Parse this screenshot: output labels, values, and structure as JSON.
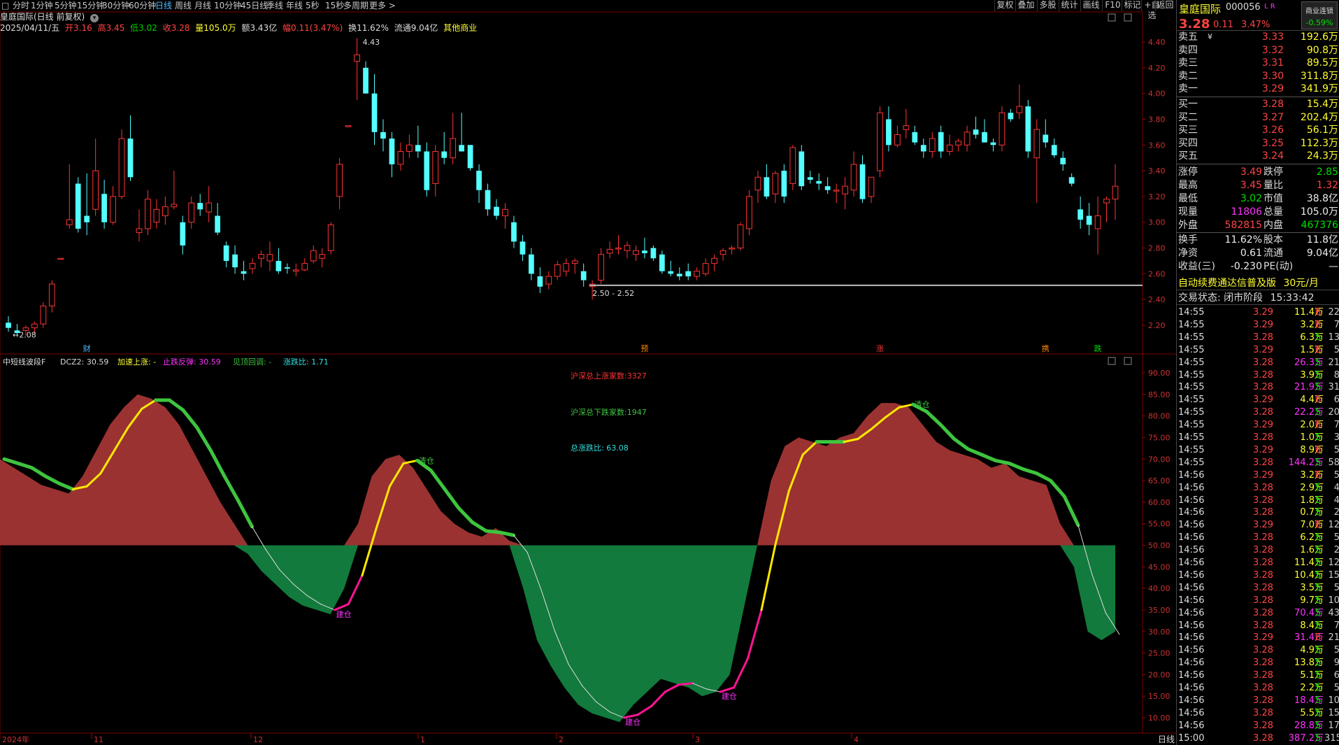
{
  "toolbar": {
    "periods": [
      "分时",
      "1分钟",
      "5分钟",
      "15分钟",
      "30分钟",
      "60分钟",
      "日线",
      "周线",
      "月线",
      "10分钟",
      "45日线",
      "季线",
      "年线",
      "5秒",
      "15秒",
      "多周期",
      "更多 >"
    ],
    "active": "日线",
    "right_buttons": [
      "复权",
      "叠加",
      "多股",
      "统计",
      "画线",
      "F10",
      "标记",
      "+自选",
      "返回"
    ]
  },
  "title": "皇庭国际(日线 前复权)",
  "infobar": {
    "date": "2025/04/11/五",
    "open": "开3.16",
    "high": "高3.45",
    "low": "低3.02",
    "close": "收3.28",
    "volume": "量105.0万",
    "amount": "额3.43亿",
    "change": "幅0.11(3.47%)",
    "turnover": "换11.62%",
    "float": "流通9.04亿",
    "other": "其他商业"
  },
  "price_axis": [
    "4.40",
    "4.20",
    "4.00",
    "3.80",
    "3.60",
    "3.40",
    "3.20",
    "3.00",
    "2.80",
    "2.60",
    "2.40",
    "2.20"
  ],
  "annotations": {
    "high_mark": "4.43",
    "low_mark": "←2.08",
    "range_label": "2.50 - 2.52",
    "events": [
      "财",
      "预",
      "涨",
      "携",
      "跌"
    ]
  },
  "indicator": {
    "name": "中短线波段F",
    "dcz2": "DCZ2: 30.59",
    "accel": "加速上涨: -",
    "stop": "止跌反弹: 30.59",
    "top": "见顶回调: -",
    "ratio": "涨跌比: 1.71",
    "up_count": "沪深总上涨家数:3327",
    "down_count": "沪深总下跌家数:1947",
    "total_ratio": "总涨跌比: 63.08",
    "axis": [
      "90.00",
      "85.00",
      "80.00",
      "75.00",
      "70.00",
      "65.00",
      "60.00",
      "55.00",
      "50.00",
      "45.00",
      "40.00",
      "35.00",
      "30.00",
      "25.00",
      "20.00",
      "15.00",
      "10.00"
    ],
    "signals": [
      "建仓",
      "清仓"
    ]
  },
  "date_axis": [
    "2024年",
    "11",
    "12",
    "1",
    "2",
    "3",
    "4"
  ],
  "period_label": "日线",
  "quote": {
    "name": "皇庭国际",
    "code": "000056",
    "flags": "L R",
    "price": "3.28",
    "change": "0.11",
    "pct": "3.47%",
    "badge_top": "商业连锁",
    "badge_pct": "-0.59%"
  },
  "sell_orders": [
    {
      "label": "卖五",
      "mark": "¥",
      "price": "3.33",
      "vol": "192.6万"
    },
    {
      "label": "卖四",
      "mark": "",
      "price": "3.32",
      "vol": "90.8万"
    },
    {
      "label": "卖三",
      "mark": "",
      "price": "3.31",
      "vol": "89.5万"
    },
    {
      "label": "卖二",
      "mark": "",
      "price": "3.30",
      "vol": "311.8万"
    },
    {
      "label": "卖一",
      "mark": "",
      "price": "3.29",
      "vol": "341.9万"
    }
  ],
  "buy_orders": [
    {
      "label": "买一",
      "price": "3.28",
      "vol": "15.4万"
    },
    {
      "label": "买二",
      "price": "3.27",
      "vol": "202.4万"
    },
    {
      "label": "买三",
      "price": "3.26",
      "vol": "56.1万"
    },
    {
      "label": "买四",
      "price": "3.25",
      "vol": "112.3万"
    },
    {
      "label": "买五",
      "price": "3.24",
      "vol": "24.3万"
    }
  ],
  "stats": [
    {
      "l1": "涨停",
      "v1": "3.49",
      "c1": "red",
      "l2": "跌停",
      "v2": "2.85",
      "c2": "green"
    },
    {
      "l1": "最高",
      "v1": "3.45",
      "c1": "red",
      "l2": "量比",
      "v2": "1.32",
      "c2": "red"
    },
    {
      "l1": "最低",
      "v1": "3.02",
      "c1": "green",
      "l2": "市值",
      "v2": "38.8亿",
      "c2": "white"
    },
    {
      "l1": "现量",
      "v1": "11806",
      "c1": "mag",
      "l2": "总量",
      "v2": "105.0万",
      "c2": "white"
    },
    {
      "l1": "外盘",
      "v1": "582815",
      "c1": "red",
      "l2": "内盘",
      "v2": "467376",
      "c2": "green"
    },
    {
      "l1": "换手",
      "v1": "11.62%",
      "c1": "white",
      "l2": "股本",
      "v2": "11.8亿",
      "c2": "white"
    },
    {
      "l1": "净资",
      "v1": "0.61",
      "c1": "white",
      "l2": "流通",
      "v2": "9.04亿",
      "c2": "white"
    },
    {
      "l1": "收益(三)",
      "v1": "-0.230",
      "c1": "white",
      "l2": "PE(动)",
      "v2": "—",
      "c2": "white"
    }
  ],
  "promo": "自动续费通达信普及版",
  "promo_price": "30元/月",
  "trade_status": "交易状态: 闭市阶段",
  "trade_time": "15:33:42",
  "ticks": [
    {
      "t": "14:55",
      "p": "3.29",
      "v": "11.4万",
      "bs": "B",
      "n": "22"
    },
    {
      "t": "14:55",
      "p": "3.29",
      "v": "3.2万",
      "bs": "B",
      "n": "7"
    },
    {
      "t": "14:55",
      "p": "3.28",
      "v": "6.3万",
      "bs": "S",
      "n": "13"
    },
    {
      "t": "14:55",
      "p": "3.29",
      "v": "1.5万",
      "bs": "B",
      "n": "5"
    },
    {
      "t": "14:55",
      "p": "3.28",
      "v": "26.3万",
      "bs": "S",
      "n": "21"
    },
    {
      "t": "14:55",
      "p": "3.28",
      "v": "3.9万",
      "bs": "S",
      "n": "8"
    },
    {
      "t": "14:55",
      "p": "3.28",
      "v": "21.9万",
      "bs": "S",
      "n": "31"
    },
    {
      "t": "14:55",
      "p": "3.29",
      "v": "4.4万",
      "bs": "B",
      "n": "6"
    },
    {
      "t": "14:55",
      "p": "3.28",
      "v": "22.2万",
      "bs": "S",
      "n": "20"
    },
    {
      "t": "14:55",
      "p": "3.29",
      "v": "2.0万",
      "bs": "B",
      "n": "7"
    },
    {
      "t": "14:55",
      "p": "3.28",
      "v": "1.0万",
      "bs": "S",
      "n": "3"
    },
    {
      "t": "14:55",
      "p": "3.29",
      "v": "8.9万",
      "bs": "B",
      "n": "5"
    },
    {
      "t": "14:55",
      "p": "3.28",
      "v": "144.2万",
      "bs": "S",
      "n": "58"
    },
    {
      "t": "14:56",
      "p": "3.29",
      "v": "3.2万",
      "bs": "B",
      "n": "5"
    },
    {
      "t": "14:56",
      "p": "3.28",
      "v": "2.9万",
      "bs": "S",
      "n": "4"
    },
    {
      "t": "14:56",
      "p": "3.28",
      "v": "1.8万",
      "bs": "S",
      "n": "4"
    },
    {
      "t": "14:56",
      "p": "3.28",
      "v": "0.7万",
      "bs": "S",
      "n": "2"
    },
    {
      "t": "14:56",
      "p": "3.29",
      "v": "7.0万",
      "bs": "B",
      "n": "12"
    },
    {
      "t": "14:56",
      "p": "3.28",
      "v": "6.2万",
      "bs": "S",
      "n": "5"
    },
    {
      "t": "14:56",
      "p": "3.28",
      "v": "1.6万",
      "bs": "S",
      "n": "2"
    },
    {
      "t": "14:56",
      "p": "3.28",
      "v": "11.4万",
      "bs": "S",
      "n": "12"
    },
    {
      "t": "14:56",
      "p": "3.28",
      "v": "10.4万",
      "bs": "S",
      "n": "15"
    },
    {
      "t": "14:56",
      "p": "3.28",
      "v": "3.5万",
      "bs": "S",
      "n": "5"
    },
    {
      "t": "14:56",
      "p": "3.28",
      "v": "9.7万",
      "bs": "S",
      "n": "10"
    },
    {
      "t": "14:56",
      "p": "3.28",
      "v": "70.4万",
      "bs": "S",
      "n": "43"
    },
    {
      "t": "14:56",
      "p": "3.28",
      "v": "8.4万",
      "bs": "S",
      "n": "7"
    },
    {
      "t": "14:56",
      "p": "3.29",
      "v": "31.4万",
      "bs": "B",
      "n": "21"
    },
    {
      "t": "14:56",
      "p": "3.28",
      "v": "4.9万",
      "bs": "S",
      "n": "5"
    },
    {
      "t": "14:56",
      "p": "3.28",
      "v": "13.8万",
      "bs": "S",
      "n": "9"
    },
    {
      "t": "14:56",
      "p": "3.28",
      "v": "5.1万",
      "bs": "S",
      "n": "6"
    },
    {
      "t": "14:56",
      "p": "3.28",
      "v": "2.2万",
      "bs": "S",
      "n": "5"
    },
    {
      "t": "14:56",
      "p": "3.28",
      "v": "18.4万",
      "bs": "S",
      "n": "10"
    },
    {
      "t": "14:56",
      "p": "3.28",
      "v": "5.5万",
      "bs": "S",
      "n": "15"
    },
    {
      "t": "14:56",
      "p": "3.28",
      "v": "28.8万",
      "bs": "S",
      "n": "17"
    },
    {
      "t": "15:00",
      "p": "3.28",
      "v": "387.2万",
      "bs": "S",
      "n": "315"
    }
  ],
  "colors": {
    "up": "#ff3333",
    "down": "#54ffff",
    "osc_up": "#9b3232",
    "osc_down": "#127a3c",
    "yellow": "#ffe800",
    "green": "#3ec43e",
    "magenta": "#ff1493"
  },
  "chart_data": {
    "type": "candlestick",
    "title": "皇庭国际(日线 前复权)",
    "ylim": [
      2.08,
      4.43
    ],
    "candles": [
      [
        2.22,
        2.27,
        2.15,
        2.18
      ],
      [
        2.16,
        2.21,
        2.11,
        2.14
      ],
      [
        2.16,
        2.2,
        2.12,
        2.18
      ],
      [
        2.18,
        2.23,
        2.13,
        2.21
      ],
      [
        2.21,
        2.38,
        2.18,
        2.35
      ],
      [
        2.35,
        2.55,
        2.3,
        2.52
      ],
      [
        2.72,
        2.72,
        2.72,
        2.72
      ],
      [
        2.98,
        3.45,
        2.95,
        3.02
      ],
      [
        3.3,
        3.35,
        2.92,
        2.95
      ],
      [
        3.05,
        3.38,
        2.9,
        3.0
      ],
      [
        3.1,
        3.65,
        3.05,
        3.4
      ],
      [
        3.22,
        3.33,
        2.95,
        3.0
      ],
      [
        3.0,
        3.28,
        2.98,
        3.2
      ],
      [
        3.2,
        3.72,
        3.18,
        3.65
      ],
      [
        3.65,
        3.83,
        3.32,
        3.35
      ],
      [
        2.92,
        3.1,
        2.85,
        2.95
      ],
      [
        2.95,
        3.25,
        2.9,
        3.18
      ],
      [
        3.0,
        3.18,
        2.95,
        3.1
      ],
      [
        3.05,
        3.2,
        2.98,
        3.12
      ],
      [
        3.12,
        3.4,
        3.1,
        3.14
      ],
      [
        3.0,
        3.05,
        2.75,
        2.82
      ],
      [
        3.0,
        3.2,
        2.95,
        3.15
      ],
      [
        3.15,
        3.22,
        3.05,
        3.1
      ],
      [
        3.08,
        3.28,
        3.0,
        3.15
      ],
      [
        3.05,
        3.15,
        2.9,
        2.92
      ],
      [
        2.82,
        2.85,
        2.65,
        2.7
      ],
      [
        2.75,
        2.82,
        2.6,
        2.65
      ],
      [
        2.62,
        2.7,
        2.55,
        2.6
      ],
      [
        2.64,
        2.72,
        2.6,
        2.68
      ],
      [
        2.72,
        2.78,
        2.65,
        2.75
      ],
      [
        2.7,
        2.85,
        2.62,
        2.75
      ],
      [
        2.7,
        2.8,
        2.6,
        2.62
      ],
      [
        2.65,
        2.68,
        2.6,
        2.64
      ],
      [
        2.62,
        2.68,
        2.58,
        2.63
      ],
      [
        2.63,
        2.72,
        2.62,
        2.68
      ],
      [
        2.7,
        2.82,
        2.68,
        2.78
      ],
      [
        2.72,
        2.8,
        2.65,
        2.75
      ],
      [
        2.78,
        3.0,
        2.75,
        2.98
      ],
      [
        3.2,
        3.5,
        3.1,
        3.45
      ],
      [
        3.75,
        3.75,
        3.75,
        3.75
      ],
      [
        4.25,
        4.43,
        3.95,
        4.3
      ],
      [
        4.2,
        4.25,
        4.0,
        4.0
      ],
      [
        4.0,
        4.15,
        3.6,
        3.7
      ],
      [
        3.7,
        3.8,
        3.55,
        3.65
      ],
      [
        3.65,
        3.7,
        3.35,
        3.45
      ],
      [
        3.45,
        3.62,
        3.4,
        3.55
      ],
      [
        3.55,
        3.68,
        3.5,
        3.6
      ],
      [
        3.6,
        3.75,
        3.5,
        3.55
      ],
      [
        3.55,
        3.62,
        3.2,
        3.25
      ],
      [
        3.3,
        3.6,
        3.2,
        3.55
      ],
      [
        3.55,
        3.7,
        3.45,
        3.5
      ],
      [
        3.5,
        3.85,
        3.45,
        3.65
      ],
      [
        3.6,
        3.85,
        3.55,
        3.55
      ],
      [
        3.6,
        3.6,
        3.4,
        3.42
      ],
      [
        3.4,
        3.45,
        3.15,
        3.25
      ],
      [
        3.25,
        3.3,
        3.05,
        3.1
      ],
      [
        3.12,
        3.18,
        3.02,
        3.05
      ],
      [
        3.05,
        3.15,
        2.95,
        3.1
      ],
      [
        3.0,
        3.05,
        2.8,
        2.85
      ],
      [
        2.85,
        2.9,
        2.7,
        2.75
      ],
      [
        2.75,
        2.8,
        2.55,
        2.6
      ],
      [
        2.58,
        2.65,
        2.45,
        2.5
      ],
      [
        2.52,
        2.62,
        2.48,
        2.58
      ],
      [
        2.58,
        2.7,
        2.55,
        2.67
      ],
      [
        2.62,
        2.72,
        2.58,
        2.68
      ],
      [
        2.68,
        2.72,
        2.6,
        2.7
      ],
      [
        2.62,
        2.68,
        2.5,
        2.55
      ],
      [
        2.5,
        2.55,
        2.4,
        2.52
      ],
      [
        2.55,
        2.8,
        2.52,
        2.75
      ],
      [
        2.76,
        2.85,
        2.72,
        2.79
      ],
      [
        2.8,
        2.9,
        2.75,
        2.8
      ],
      [
        2.78,
        2.85,
        2.72,
        2.82
      ],
      [
        2.75,
        2.82,
        2.7,
        2.78
      ],
      [
        2.78,
        2.88,
        2.72,
        2.76
      ],
      [
        2.8,
        2.82,
        2.7,
        2.72
      ],
      [
        2.75,
        2.78,
        2.6,
        2.62
      ],
      [
        2.62,
        2.7,
        2.58,
        2.6
      ],
      [
        2.6,
        2.65,
        2.55,
        2.58
      ],
      [
        2.62,
        2.68,
        2.55,
        2.58
      ],
      [
        2.58,
        2.65,
        2.55,
        2.62
      ],
      [
        2.6,
        2.72,
        2.58,
        2.68
      ],
      [
        2.68,
        2.75,
        2.62,
        2.72
      ],
      [
        2.75,
        2.8,
        2.7,
        2.78
      ],
      [
        2.8,
        2.82,
        2.75,
        2.8
      ],
      [
        2.8,
        3.0,
        2.78,
        2.98
      ],
      [
        2.95,
        3.25,
        2.9,
        3.2
      ],
      [
        3.25,
        3.4,
        3.15,
        3.35
      ],
      [
        3.35,
        3.45,
        3.18,
        3.2
      ],
      [
        3.22,
        3.4,
        3.15,
        3.38
      ],
      [
        3.4,
        3.45,
        3.15,
        3.2
      ],
      [
        3.3,
        3.6,
        3.25,
        3.58
      ],
      [
        3.55,
        3.6,
        3.25,
        3.28
      ],
      [
        3.35,
        3.4,
        3.3,
        3.33
      ],
      [
        3.32,
        3.38,
        3.25,
        3.3
      ],
      [
        3.28,
        3.35,
        3.22,
        3.25
      ],
      [
        3.25,
        3.3,
        3.15,
        3.25
      ],
      [
        3.22,
        3.35,
        3.1,
        3.28
      ],
      [
        3.25,
        3.55,
        3.2,
        3.45
      ],
      [
        3.45,
        3.52,
        3.15,
        3.18
      ],
      [
        3.2,
        3.35,
        3.15,
        3.35
      ],
      [
        3.4,
        3.9,
        3.35,
        3.85
      ],
      [
        3.8,
        3.9,
        3.55,
        3.6
      ],
      [
        3.6,
        3.75,
        3.58,
        3.68
      ],
      [
        3.72,
        3.88,
        3.65,
        3.75
      ],
      [
        3.7,
        3.75,
        3.6,
        3.62
      ],
      [
        3.6,
        3.65,
        3.5,
        3.55
      ],
      [
        3.55,
        3.7,
        3.5,
        3.65
      ],
      [
        3.7,
        3.75,
        3.5,
        3.55
      ],
      [
        3.55,
        3.68,
        3.52,
        3.6
      ],
      [
        3.6,
        3.65,
        3.55,
        3.63
      ],
      [
        3.6,
        3.75,
        3.55,
        3.7
      ],
      [
        3.72,
        3.82,
        3.65,
        3.68
      ],
      [
        3.7,
        3.8,
        3.62,
        3.62
      ],
      [
        3.62,
        3.65,
        3.55,
        3.6
      ],
      [
        3.6,
        3.9,
        3.55,
        3.85
      ],
      [
        3.85,
        3.88,
        3.78,
        3.8
      ],
      [
        3.85,
        4.07,
        3.8,
        3.9
      ],
      [
        3.9,
        3.95,
        3.5,
        3.55
      ],
      [
        3.5,
        3.8,
        3.15,
        3.72
      ],
      [
        3.68,
        3.8,
        3.58,
        3.62
      ],
      [
        3.6,
        3.65,
        3.5,
        3.52
      ],
      [
        3.5,
        3.55,
        3.4,
        3.45
      ],
      [
        3.35,
        3.38,
        3.28,
        3.3
      ],
      [
        3.1,
        3.2,
        2.95,
        3.02
      ],
      [
        3.05,
        3.15,
        2.9,
        2.98
      ],
      [
        2.95,
        3.2,
        2.75,
        3.05
      ],
      [
        3.15,
        3.2,
        3.0,
        3.18
      ],
      [
        3.18,
        3.45,
        3.02,
        3.28
      ]
    ],
    "oscillator": [
      70,
      68,
      66,
      64,
      63,
      62,
      66,
      72,
      78,
      82,
      85,
      84,
      82,
      78,
      72,
      66,
      60,
      55,
      48,
      44,
      41,
      38,
      36,
      35,
      34,
      40,
      55,
      66,
      70,
      71,
      68,
      63,
      58,
      55,
      53,
      52,
      54,
      51,
      40,
      28,
      22,
      17,
      13,
      11,
      10,
      9,
      13,
      16,
      19,
      18,
      17,
      15,
      16,
      20,
      35,
      50,
      65,
      73,
      75,
      74,
      73,
      75,
      76,
      80,
      83,
      83,
      82,
      78,
      74,
      72,
      71,
      70,
      68,
      69,
      66,
      65,
      64,
      55,
      45,
      30,
      28,
      30
    ],
    "oscillator_ylim": [
      10,
      90
    ]
  }
}
